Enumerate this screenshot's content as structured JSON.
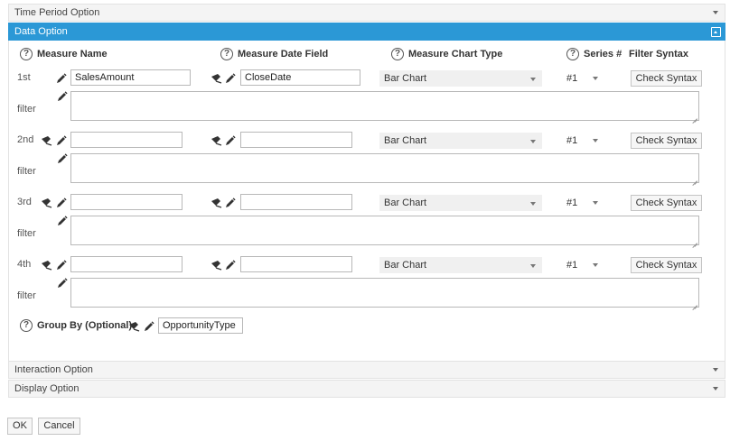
{
  "sections": {
    "time_period": "Time Period Option",
    "data_option": "Data Option",
    "interaction": "Interaction Option",
    "display": "Display Option"
  },
  "headers": {
    "help_glyph": "?",
    "measure_name": "Measure Name",
    "measure_date_field": "Measure Date Field",
    "measure_chart_type": "Measure Chart Type",
    "series": "Series #",
    "filter_syntax": "Filter Syntax"
  },
  "rows": [
    {
      "label": "1st",
      "measure_name": "SalesAmount",
      "date_field": "CloseDate",
      "chart_type": "Bar Chart",
      "series": "#1",
      "check_label": "Check Syntax",
      "filter_label": "filter"
    },
    {
      "label": "2nd",
      "measure_name": "",
      "date_field": "",
      "chart_type": "Bar Chart",
      "series": "#1",
      "check_label": "Check Syntax",
      "filter_label": "filter"
    },
    {
      "label": "3rd",
      "measure_name": "",
      "date_field": "",
      "chart_type": "Bar Chart",
      "series": "#1",
      "check_label": "Check Syntax",
      "filter_label": "filter"
    },
    {
      "label": "4th",
      "measure_name": "",
      "date_field": "",
      "chart_type": "Bar Chart",
      "series": "#1",
      "check_label": "Check Syntax",
      "filter_label": "filter"
    }
  ],
  "group_by": {
    "label": "Group By (Optional):",
    "value": "OpportunityType"
  },
  "footer": {
    "ok": "OK",
    "cancel": "Cancel"
  },
  "colors": {
    "accent": "#2b98d6",
    "header_bg": "#f4f4f4"
  }
}
